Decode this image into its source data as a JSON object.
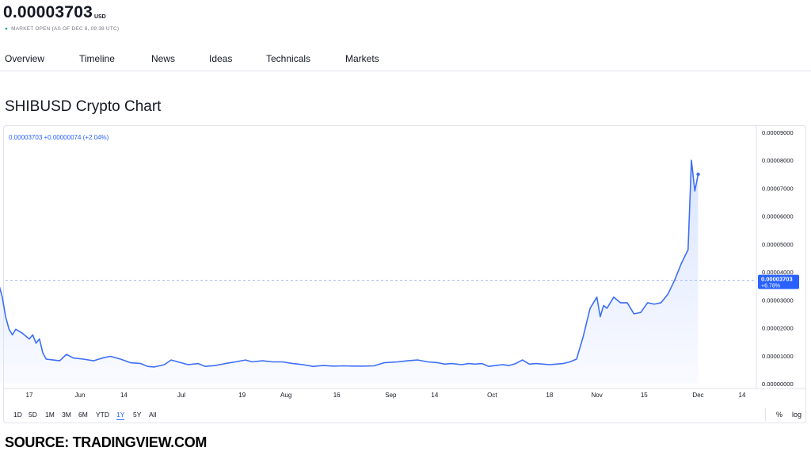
{
  "header": {
    "price": "0.00003703",
    "currency": "USD",
    "market_status": "MARKET OPEN",
    "as_of": "(AS OF DEC 8, 09:38 UTC)",
    "status_color": "#26a69a"
  },
  "tabs": [
    {
      "label": "Overview",
      "active": true
    },
    {
      "label": "Timeline",
      "active": false
    },
    {
      "label": "News",
      "active": false
    },
    {
      "label": "Ideas",
      "active": false
    },
    {
      "label": "Technicals",
      "active": false
    },
    {
      "label": "Markets",
      "active": false
    }
  ],
  "section_title": "SHIBUSD Crypto Chart",
  "chart_legend": "0.00003703 +0.00000074 (+2.04%)",
  "range_buttons": [
    {
      "label": "1D",
      "active": false
    },
    {
      "label": "5D",
      "active": false
    },
    {
      "label": "1M",
      "active": false
    },
    {
      "label": "3M",
      "active": false
    },
    {
      "label": "6M",
      "active": false
    },
    {
      "label": "YTD",
      "active": false
    },
    {
      "label": "1Y",
      "active": true
    },
    {
      "label": "5Y",
      "active": false
    },
    {
      "label": "All",
      "active": false
    }
  ],
  "scale_buttons": {
    "percent": "%",
    "log": "log"
  },
  "source": "SOURCE: TRADINGVIEW.COM",
  "colors": {
    "accent": "#2962ff",
    "line": "#3d6ff5",
    "fill": "#d9e3ff",
    "grid": "#e0e3eb"
  },
  "chart_data": {
    "type": "area",
    "title": "",
    "xlabel": "",
    "ylabel": "",
    "ylim": [
      0,
      9e-05
    ],
    "y_ticks": [
      "0.00009000",
      "0.00008000",
      "0.00007000",
      "0.00006000",
      "0.00005000",
      "0.00004000",
      "0.00003000",
      "0.00002000",
      "0.00001000",
      "0.00000000"
    ],
    "y_tick_values": [
      9e-05,
      8e-05,
      7e-05,
      6e-05,
      5e-05,
      4e-05,
      3e-05,
      2e-05,
      1e-05,
      0
    ],
    "x_ticks": [
      {
        "label": "17",
        "date": "2021-05-17"
      },
      {
        "label": "Jun",
        "date": "2021-06-01"
      },
      {
        "label": "14",
        "date": "2021-06-14"
      },
      {
        "label": "Jul",
        "date": "2021-07-01"
      },
      {
        "label": "19",
        "date": "2021-07-19"
      },
      {
        "label": "Aug",
        "date": "2021-08-01"
      },
      {
        "label": "16",
        "date": "2021-08-16"
      },
      {
        "label": "Sep",
        "date": "2021-09-01"
      },
      {
        "label": "14",
        "date": "2021-09-14"
      },
      {
        "label": "Oct",
        "date": "2021-10-01"
      },
      {
        "label": "18",
        "date": "2021-10-18"
      },
      {
        "label": "Nov",
        "date": "2021-11-01"
      },
      {
        "label": "15",
        "date": "2021-11-15"
      },
      {
        "label": "Dec",
        "date": "2021-12-01"
      },
      {
        "label": "14",
        "date": "2021-12-14"
      }
    ],
    "last_value_label": "0.00003703",
    "last_change_label": "+6.78%",
    "last_value": 3.703e-05,
    "grid": false,
    "series": [
      {
        "points": [
          [
            "2021-05-08",
            3.55e-05
          ],
          [
            "2021-05-09",
            3.1e-05
          ],
          [
            "2021-05-10",
            2.4e-05
          ],
          [
            "2021-05-11",
            1.95e-05
          ],
          [
            "2021-05-12",
            1.75e-05
          ],
          [
            "2021-05-13",
            1.95e-05
          ],
          [
            "2021-05-15",
            1.8e-05
          ],
          [
            "2021-05-17",
            1.6e-05
          ],
          [
            "2021-05-18",
            1.75e-05
          ],
          [
            "2021-05-19",
            1.45e-05
          ],
          [
            "2021-05-20",
            1.6e-05
          ],
          [
            "2021-05-21",
            1.1e-05
          ],
          [
            "2021-05-22",
            8.8e-06
          ],
          [
            "2021-05-24",
            8.5e-06
          ],
          [
            "2021-05-26",
            8.2e-06
          ],
          [
            "2021-05-28",
            1.05e-05
          ],
          [
            "2021-05-30",
            9.2e-06
          ],
          [
            "2021-06-02",
            8.8e-06
          ],
          [
            "2021-06-05",
            8.2e-06
          ],
          [
            "2021-06-08",
            9.3e-06
          ],
          [
            "2021-06-10",
            9.8e-06
          ],
          [
            "2021-06-13",
            8.8e-06
          ],
          [
            "2021-06-16",
            7.5e-06
          ],
          [
            "2021-06-19",
            7.2e-06
          ],
          [
            "2021-06-21",
            6.2e-06
          ],
          [
            "2021-06-23",
            6e-06
          ],
          [
            "2021-06-26",
            6.8e-06
          ],
          [
            "2021-06-28",
            8.5e-06
          ],
          [
            "2021-07-01",
            7.5e-06
          ],
          [
            "2021-07-03",
            6.8e-06
          ],
          [
            "2021-07-06",
            7.2e-06
          ],
          [
            "2021-07-08",
            6.2e-06
          ],
          [
            "2021-07-11",
            6.5e-06
          ],
          [
            "2021-07-14",
            7.2e-06
          ],
          [
            "2021-07-17",
            7.8e-06
          ],
          [
            "2021-07-20",
            8.5e-06
          ],
          [
            "2021-07-22",
            7.8e-06
          ],
          [
            "2021-07-25",
            8.2e-06
          ],
          [
            "2021-07-28",
            7.8e-06
          ],
          [
            "2021-07-31",
            7.8e-06
          ],
          [
            "2021-08-03",
            7.2e-06
          ],
          [
            "2021-08-06",
            6.8e-06
          ],
          [
            "2021-08-09",
            6.2e-06
          ],
          [
            "2021-08-12",
            6.5e-06
          ],
          [
            "2021-08-15",
            6.3e-06
          ],
          [
            "2021-08-18",
            6.4e-06
          ],
          [
            "2021-08-21",
            6.3e-06
          ],
          [
            "2021-08-24",
            6.3e-06
          ],
          [
            "2021-08-27",
            6.4e-06
          ],
          [
            "2021-08-30",
            7.5e-06
          ],
          [
            "2021-09-03",
            7.8e-06
          ],
          [
            "2021-09-06",
            8.2e-06
          ],
          [
            "2021-09-09",
            8.5e-06
          ],
          [
            "2021-09-12",
            7.8e-06
          ],
          [
            "2021-09-15",
            7.5e-06
          ],
          [
            "2021-09-17",
            7e-06
          ],
          [
            "2021-09-19",
            7.2e-06
          ],
          [
            "2021-09-22",
            6.8e-06
          ],
          [
            "2021-09-24",
            7.2e-06
          ],
          [
            "2021-09-26",
            7e-06
          ],
          [
            "2021-09-28",
            7.2e-06
          ],
          [
            "2021-09-30",
            6.2e-06
          ],
          [
            "2021-10-02",
            6.5e-06
          ],
          [
            "2021-10-04",
            6.8e-06
          ],
          [
            "2021-10-06",
            6.5e-06
          ],
          [
            "2021-10-08",
            7.2e-06
          ],
          [
            "2021-10-10",
            8.5e-06
          ],
          [
            "2021-10-12",
            7e-06
          ],
          [
            "2021-10-14",
            7.2e-06
          ],
          [
            "2021-10-16",
            7e-06
          ],
          [
            "2021-10-18",
            6.8e-06
          ],
          [
            "2021-10-20",
            7e-06
          ],
          [
            "2021-10-22",
            7.2e-06
          ],
          [
            "2021-10-24",
            7.8e-06
          ],
          [
            "2021-10-26",
            8.8e-06
          ],
          [
            "2021-10-28",
            1.7e-05
          ],
          [
            "2021-10-30",
            2.7e-05
          ],
          [
            "2021-11-01",
            3.1e-05
          ],
          [
            "2021-11-02",
            2.4e-05
          ],
          [
            "2021-11-03",
            2.8e-05
          ],
          [
            "2021-11-04",
            2.7e-05
          ],
          [
            "2021-11-06",
            3.1e-05
          ],
          [
            "2021-11-08",
            2.9e-05
          ],
          [
            "2021-11-10",
            2.9e-05
          ],
          [
            "2021-11-12",
            2.5e-05
          ],
          [
            "2021-11-14",
            2.55e-05
          ],
          [
            "2021-11-16",
            2.9e-05
          ],
          [
            "2021-11-18",
            2.85e-05
          ],
          [
            "2021-11-20",
            2.9e-05
          ],
          [
            "2021-11-22",
            3.2e-05
          ],
          [
            "2021-11-24",
            3.7e-05
          ],
          [
            "2021-11-26",
            4.3e-05
          ],
          [
            "2021-11-28",
            4.8e-05
          ],
          [
            "2021-11-29",
            8e-05
          ],
          [
            "2021-11-30",
            6.9e-05
          ],
          [
            "2021-12-01",
            7.5e-05
          ]
        ]
      }
    ]
  }
}
